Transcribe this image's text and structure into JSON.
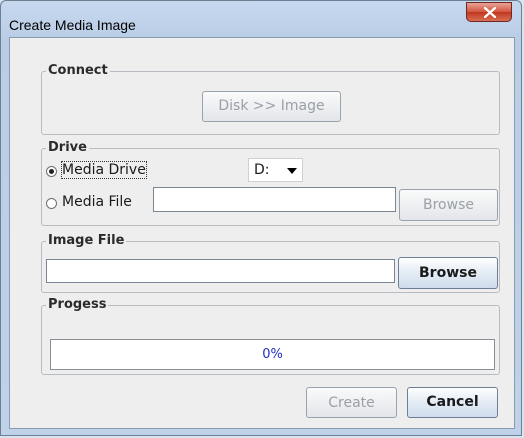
{
  "window": {
    "title": "Create Media Image",
    "close_label": "X"
  },
  "connect": {
    "label": "Connect",
    "disk_button": "Disk >> Image"
  },
  "drive": {
    "label": "Drive",
    "media_drive_label": "Media Drive",
    "media_drive_selected": true,
    "drive_letter": "D:",
    "media_file_label": "Media File",
    "media_file_value": "",
    "browse_label": "Browse"
  },
  "image_file": {
    "label": "Image File",
    "value": "",
    "browse_label": "Browse"
  },
  "progress": {
    "label": "Progess",
    "value_text": "0%",
    "fraction": 0
  },
  "footer": {
    "create_label": "Create",
    "cancel_label": "Cancel"
  }
}
